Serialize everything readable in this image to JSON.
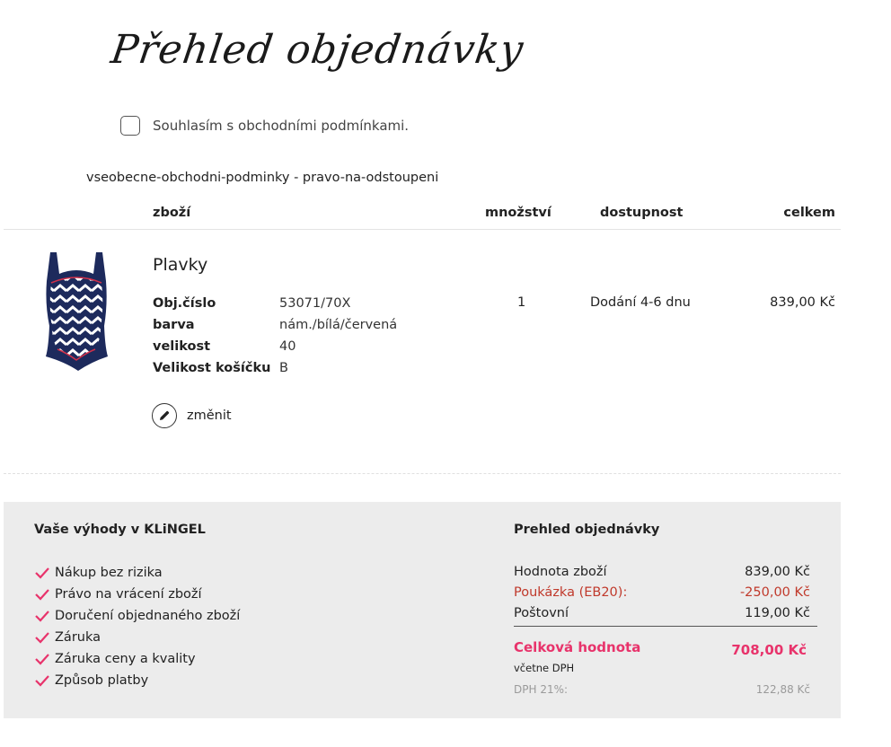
{
  "page_title": "Přehled objednávky",
  "consent_label": "Souhlasím s obchodními podmínkami.",
  "terms_links": "vseobecne-obchodni-podminky - pravo-na-odstoupeni",
  "table": {
    "headers": {
      "product": "zboží",
      "quantity": "množství",
      "availability": "dostupnost",
      "total": "celkem"
    },
    "item": {
      "name": "Plavky",
      "image_icon": "swimsuit-image",
      "attributes": [
        {
          "label": "Obj.číslo",
          "value": "53071/70X"
        },
        {
          "label": "barva",
          "value": "nám./bílá/červená"
        },
        {
          "label": "velikost",
          "value": "40"
        },
        {
          "label": "Velikost košíčku",
          "value": "B"
        }
      ],
      "quantity": "1",
      "availability": "Dodání 4-6 dnu",
      "price": "839,00 Kč",
      "edit_label": "změnit",
      "edit_icon": "pencil-icon"
    }
  },
  "benefits": {
    "title": "Vaše výhody v KLiNGEL",
    "items": [
      "Nákup bez rizika",
      "Právo na vrácení zboží",
      "Doručení objednaného zboží",
      "Záruka",
      "Záruka ceny a kvality",
      "Způsob platby"
    ],
    "check_color": "#e8336b"
  },
  "summary": {
    "title": "Prehled objednávky",
    "rows": [
      {
        "label": "Hodnota zboží",
        "value": "839,00 Kč"
      },
      {
        "label": "Poukázka (EB20):",
        "value": "-250,00 Kč"
      },
      {
        "label": "Poštovní",
        "value": "119,00 Kč"
      }
    ],
    "total_label": "Celková hodnota",
    "total_value": "708,00 Kč",
    "incl_vat": "včetne DPH",
    "vat_label": "DPH 21%:",
    "vat_value": "122,88 Kč"
  },
  "colors": {
    "accent_pink": "#e8336b",
    "voucher_red": "#c0392b",
    "summary_bg": "#ececec"
  }
}
